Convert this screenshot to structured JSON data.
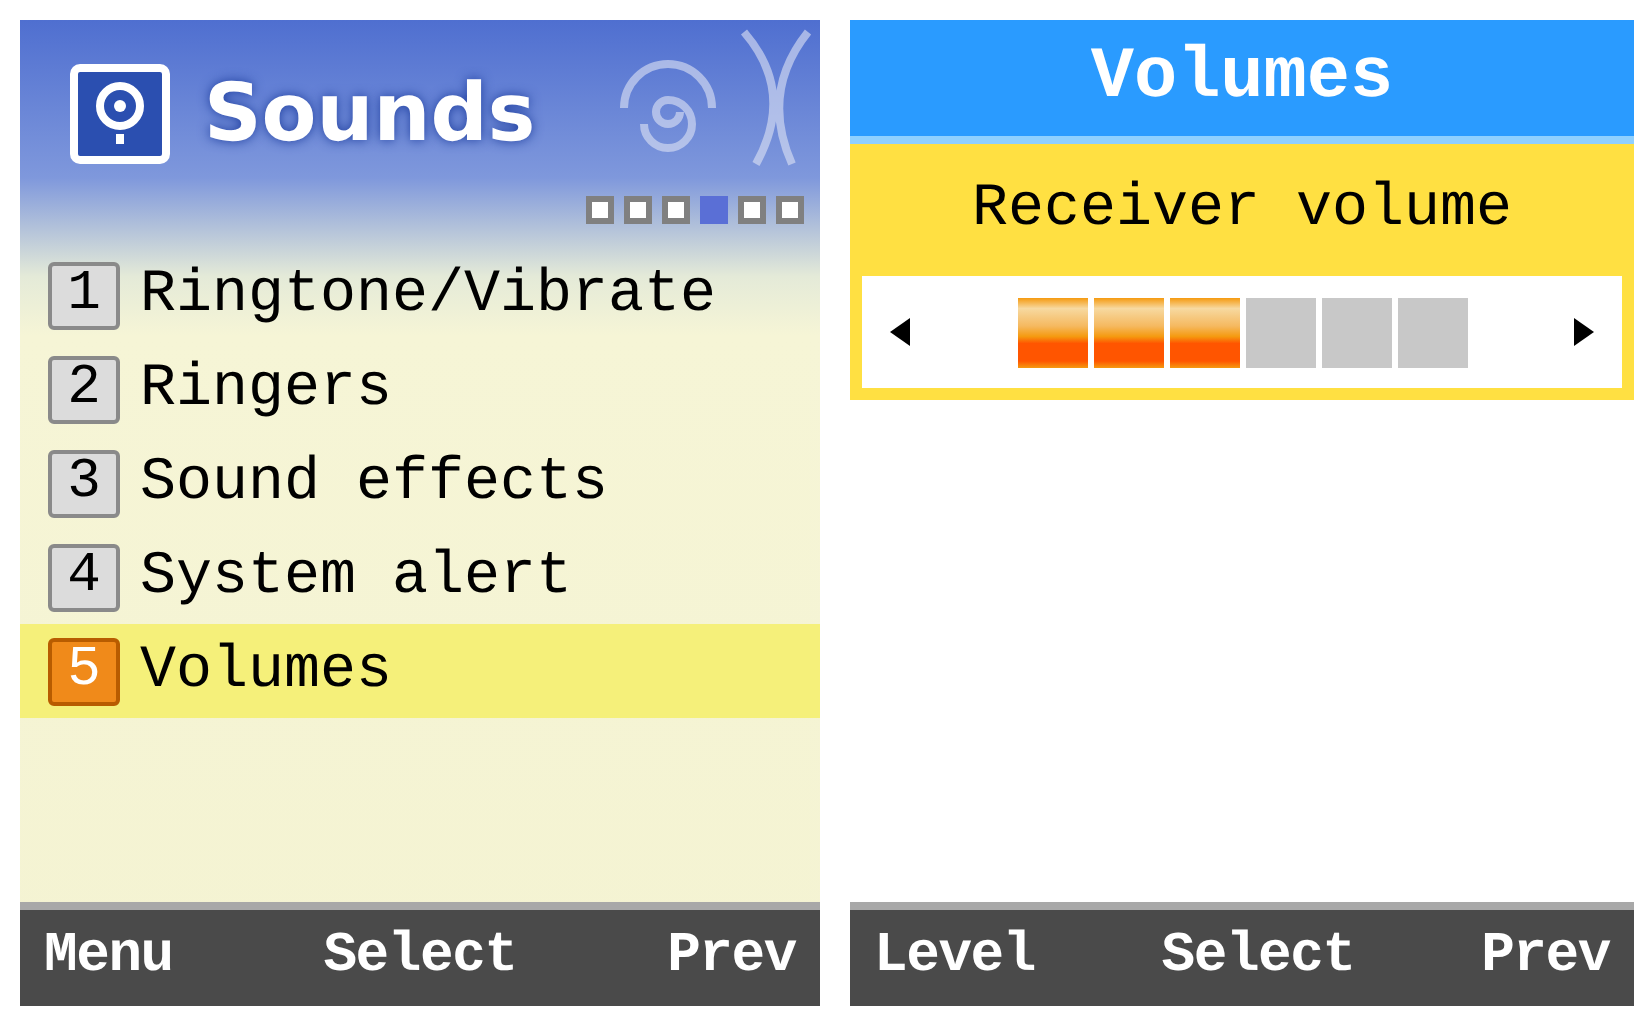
{
  "menu_screen": {
    "title": "Sounds",
    "page_dots": [
      {
        "selected": false
      },
      {
        "selected": false
      },
      {
        "selected": false
      },
      {
        "selected": true
      },
      {
        "selected": false
      },
      {
        "selected": false
      }
    ],
    "items": [
      {
        "number": "1",
        "label": "Ringtone/Vibrate",
        "selected": false
      },
      {
        "number": "2",
        "label": "Ringers",
        "selected": false
      },
      {
        "number": "3",
        "label": "Sound effects",
        "selected": false
      },
      {
        "number": "4",
        "label": "System alert",
        "selected": false
      },
      {
        "number": "5",
        "label": "Volumes",
        "selected": true
      }
    ],
    "softkeys": [
      "Menu",
      "Select",
      "Prev"
    ]
  },
  "volume_screen": {
    "title": "Volumes",
    "setting": "Receiver volume",
    "level": 0.5,
    "softkeys": [
      "Level",
      "Select",
      "Prev"
    ]
  }
}
